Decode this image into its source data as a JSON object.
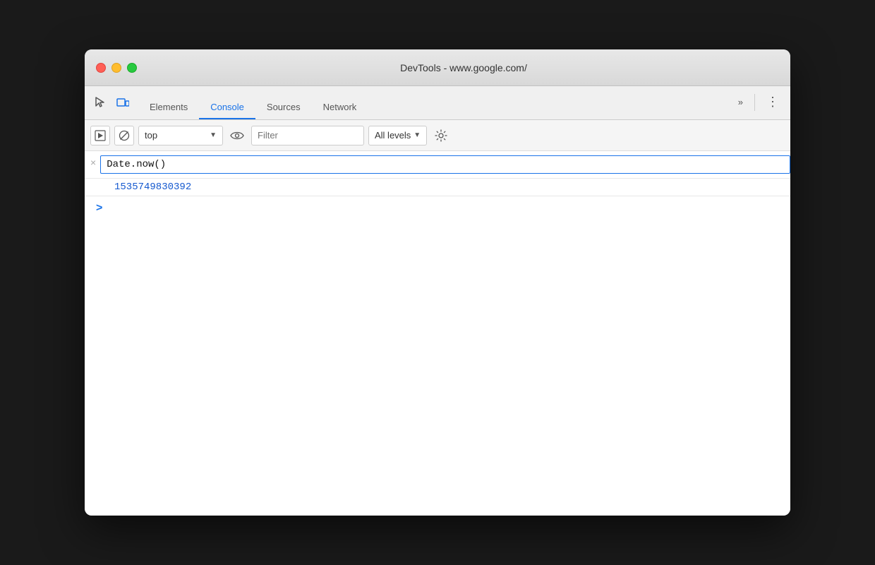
{
  "window": {
    "title": "DevTools - www.google.com/"
  },
  "tabs": [
    {
      "id": "elements",
      "label": "Elements",
      "active": false
    },
    {
      "id": "console",
      "label": "Console",
      "active": true
    },
    {
      "id": "sources",
      "label": "Sources",
      "active": false
    },
    {
      "id": "network",
      "label": "Network",
      "active": false
    }
  ],
  "toolbar": {
    "context_value": "top",
    "context_placeholder": "top",
    "filter_placeholder": "Filter",
    "levels_label": "All levels"
  },
  "console": {
    "command": "Date.now()",
    "result": "1535749830392",
    "close_label": "×",
    "prompt_symbol": ">"
  },
  "icons": {
    "inspect": "⊡",
    "device": "⬜",
    "more_tabs": "»",
    "menu": "⋮",
    "stop": "⊘",
    "eye": "👁",
    "gear": "⚙"
  }
}
